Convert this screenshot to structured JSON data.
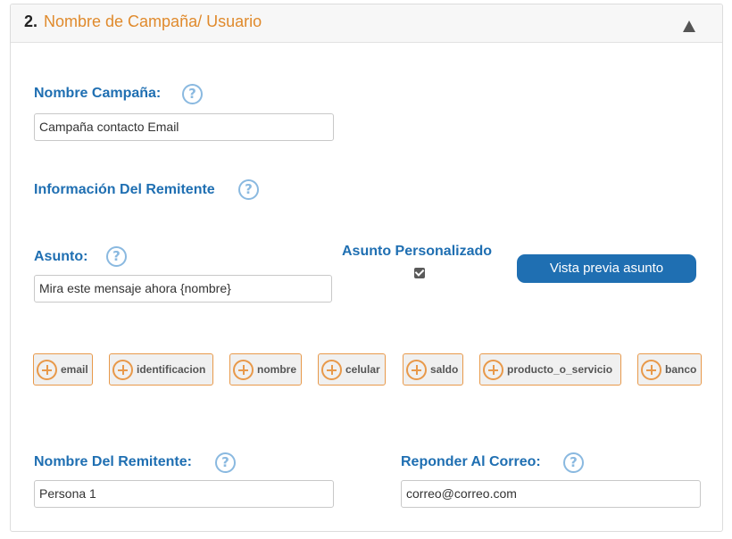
{
  "section": {
    "number": "2.",
    "title": "Nombre de Campaña/ Usuario"
  },
  "campaign": {
    "label": "Nombre Campaña:",
    "value": "Campaña contacto Email"
  },
  "sender_info": {
    "label": "Información Del Remitente"
  },
  "subject": {
    "label": "Asunto:",
    "value": "Mira este mensaje ahora {nombre}",
    "custom_label": "Asunto Personalizado",
    "custom_checked": true,
    "preview_button": "Vista previa asunto"
  },
  "tags": [
    {
      "label": "email"
    },
    {
      "label": "identificacion"
    },
    {
      "label": "nombre"
    },
    {
      "label": "celular"
    },
    {
      "label": "saldo"
    },
    {
      "label": "producto_o_servicio"
    },
    {
      "label": "banco"
    }
  ],
  "sender_name": {
    "label": "Nombre Del Remitente:",
    "value": "Persona 1"
  },
  "reply_to": {
    "label": "Reponder Al Correo:",
    "value": "correo@correo.com"
  },
  "icons": {
    "help": "question-mark-icon",
    "add": "plus-circle-icon",
    "collapse": "triangle-up-icon"
  },
  "colors": {
    "label_blue": "#1f6fb2",
    "title_orange": "#e08a2c",
    "tag_border": "#e8994a",
    "help_icon": "#8ab9e0",
    "button_bg": "#1f6fb2"
  }
}
